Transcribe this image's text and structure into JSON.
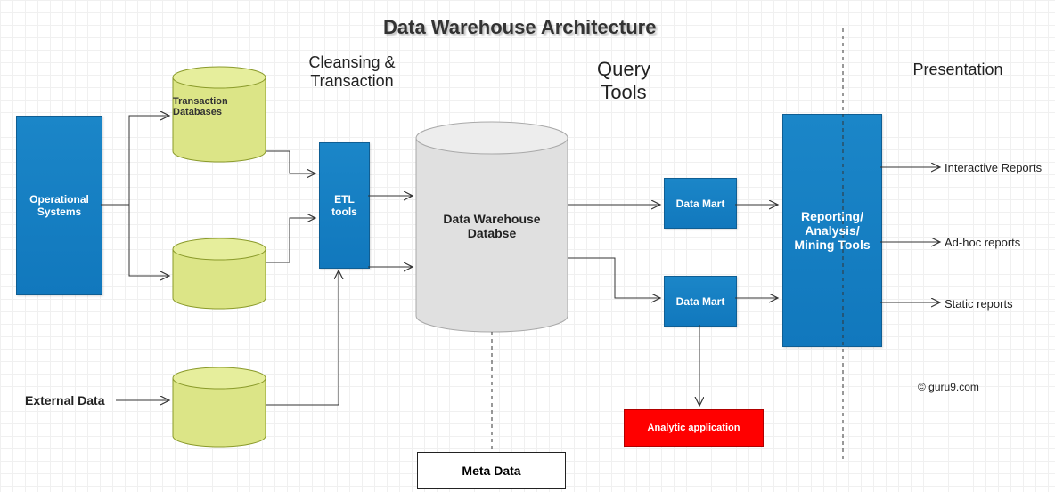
{
  "title": "Data Warehouse Architecture",
  "sections": {
    "cleansing": "Cleansing &\nTransaction",
    "query": "Query\nTools",
    "presentation": "Presentation"
  },
  "nodes": {
    "operational_systems": "Operational\nSystems",
    "transaction_databases": "Transaction\nDatabases",
    "external_data": "External Data",
    "etl_tools": "ETL\ntools",
    "dw_database": "Data Warehouse\nDatabse",
    "data_mart_1": "Data Mart",
    "data_mart_2": "Data Mart",
    "analytic_app": "Analytic application",
    "reporting_tools": "Reporting/\nAnalysis/\nMining Tools",
    "meta_data": "Meta Data"
  },
  "outputs": {
    "interactive_reports": "Interactive Reports",
    "adhoc_reports": "Ad-hoc reports",
    "static_reports": "Static reports"
  },
  "credit": "© guru9.com",
  "colors": {
    "blue": "#1581c4",
    "yellow_fill": "#e2ea8e",
    "yellow_stroke": "#8a9a2a",
    "grey_fill": "#e3e3e3",
    "grey_stroke": "#a9a9a9",
    "red": "#ff0000"
  }
}
